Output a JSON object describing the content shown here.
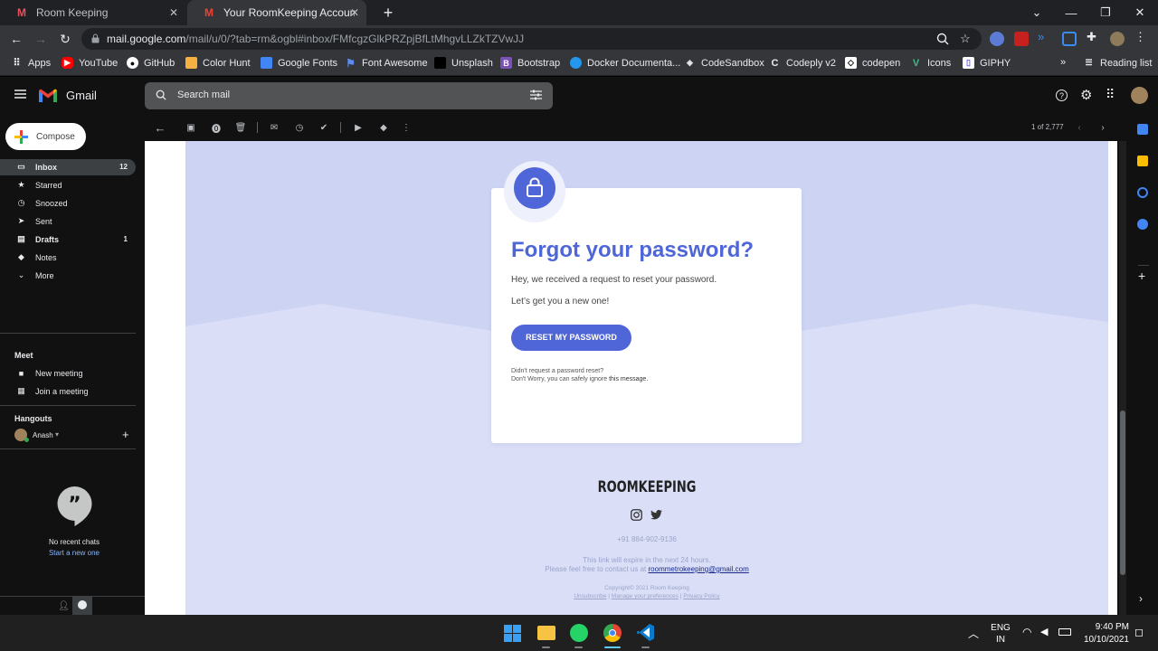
{
  "browser": {
    "tabs": [
      {
        "title": "Room Keeping",
        "active": false
      },
      {
        "title": "Your RoomKeeping Account Pass",
        "active": true
      }
    ],
    "url_host": "mail.google.com",
    "url_path": "/mail/u/0/?tab=rm&ogbl#inbox/FMfcgzGlkPRZpjBfLtMhgvLLZkTZVwJJ",
    "bookmarks": [
      "Apps",
      "YouTube",
      "GitHub",
      "Color Hunt",
      "Google Fonts",
      "Font Awesome",
      "Unsplash",
      "Bootstrap",
      "Docker Documenta...",
      "CodeSandbox",
      "Codeply v2",
      "codepen",
      "Icons",
      "GIPHY"
    ],
    "reading_list": "Reading list"
  },
  "gmail": {
    "logo_text": "Gmail",
    "search_placeholder": "Search mail",
    "compose_label": "Compose",
    "nav": [
      {
        "label": "Inbox",
        "count": "12",
        "icon": "inbox-icon"
      },
      {
        "label": "Starred",
        "count": "",
        "icon": "star-icon"
      },
      {
        "label": "Snoozed",
        "count": "",
        "icon": "clock-icon"
      },
      {
        "label": "Sent",
        "count": "",
        "icon": "send-icon"
      },
      {
        "label": "Drafts",
        "count": "1",
        "icon": "draft-icon"
      },
      {
        "label": "Notes",
        "count": "",
        "icon": "label-icon"
      },
      {
        "label": "More",
        "count": "",
        "icon": "chevron-down-icon"
      }
    ],
    "meet": {
      "title": "Meet",
      "new_meeting": "New meeting",
      "join_meeting": "Join a meeting"
    },
    "hangouts": {
      "title": "Hangouts",
      "user": "Anash",
      "no_chats": "No recent chats",
      "start_new": "Start a new one"
    },
    "pagination": "1 of 2,777"
  },
  "email": {
    "heading": "Forgot your password?",
    "line1": "Hey, we received a request to reset your password.",
    "line2": "Let’s get you a new one!",
    "button": "RESET MY PASSWORD",
    "note1": "Didn't request a password reset?",
    "note2_prefix": "Don't Worry, you can safely ignore ",
    "note2_bold": "this message.",
    "brand": "ROOMKEEPING",
    "phone": "+91 884-902-9136",
    "expire": "This link will expire in the next 24 hours.",
    "contact_prefix": "Please feel free to contact us at ",
    "contact_email": "roommetrokeeping@gmail.com",
    "copyright": "Copyright© 2021 Room Keeping",
    "unsubscribe": "Unsubscribe",
    "prefs": "Manage your preferences",
    "privacy": "Privacy Policy",
    "accent": "#4f66d9"
  },
  "taskbar": {
    "lang1": "ENG",
    "lang2": "IN",
    "time": "9:40 PM",
    "date": "10/10/2021"
  }
}
